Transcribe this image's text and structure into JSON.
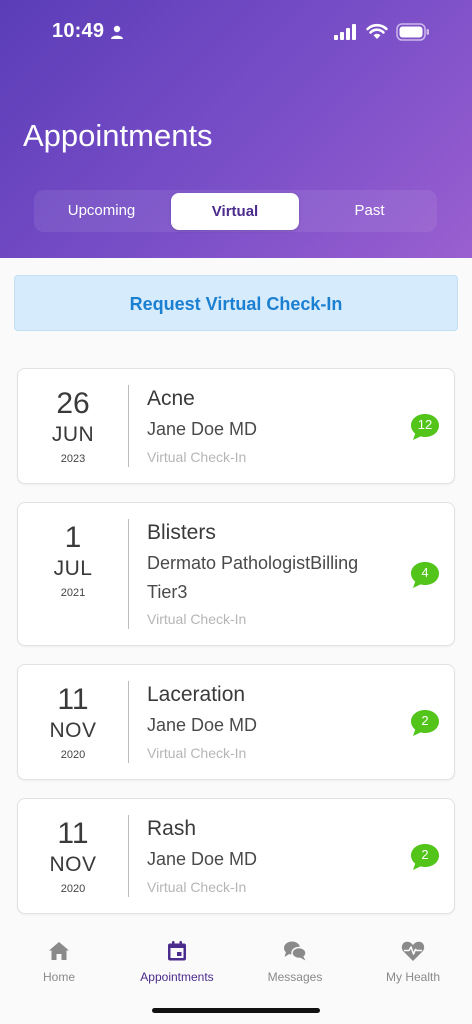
{
  "status_bar": {
    "time": "10:49"
  },
  "header": {
    "title": "Appointments",
    "tabs": [
      {
        "label": "Upcoming"
      },
      {
        "label": "Virtual"
      },
      {
        "label": "Past"
      }
    ]
  },
  "checkin": {
    "label": "Request Virtual Check-In"
  },
  "appointments": [
    {
      "day": "26",
      "month": "JUN",
      "year": "2023",
      "title": "Acne",
      "provider": "Jane Doe MD",
      "type": "Virtual Check-In",
      "messages": "12"
    },
    {
      "day": "1",
      "month": "JUL",
      "year": "2021",
      "title": "Blisters",
      "provider": "Dermato PathologistBilling Tier3",
      "type": "Virtual Check-In",
      "messages": "4"
    },
    {
      "day": "11",
      "month": "NOV",
      "year": "2020",
      "title": "Laceration",
      "provider": "Jane Doe MD",
      "type": "Virtual Check-In",
      "messages": "2"
    },
    {
      "day": "11",
      "month": "NOV",
      "year": "2020",
      "title": "Rash",
      "provider": "Jane Doe MD",
      "type": "Virtual Check-In",
      "messages": "2"
    }
  ],
  "tabbar": {
    "items": [
      {
        "label": "Home",
        "icon": "home-icon"
      },
      {
        "label": "Appointments",
        "icon": "calendar-icon"
      },
      {
        "label": "Messages",
        "icon": "chat-bubbles-icon"
      },
      {
        "label": "My Health",
        "icon": "heart-pulse-icon"
      }
    ]
  },
  "colors": {
    "header_gradient_start": "#5b3db8",
    "header_gradient_end": "#9a5fd0",
    "accent": "#4b2b8c",
    "checkin_bg": "#d6ebfb",
    "checkin_text": "#1b7fd2",
    "badge": "#52c41a"
  }
}
